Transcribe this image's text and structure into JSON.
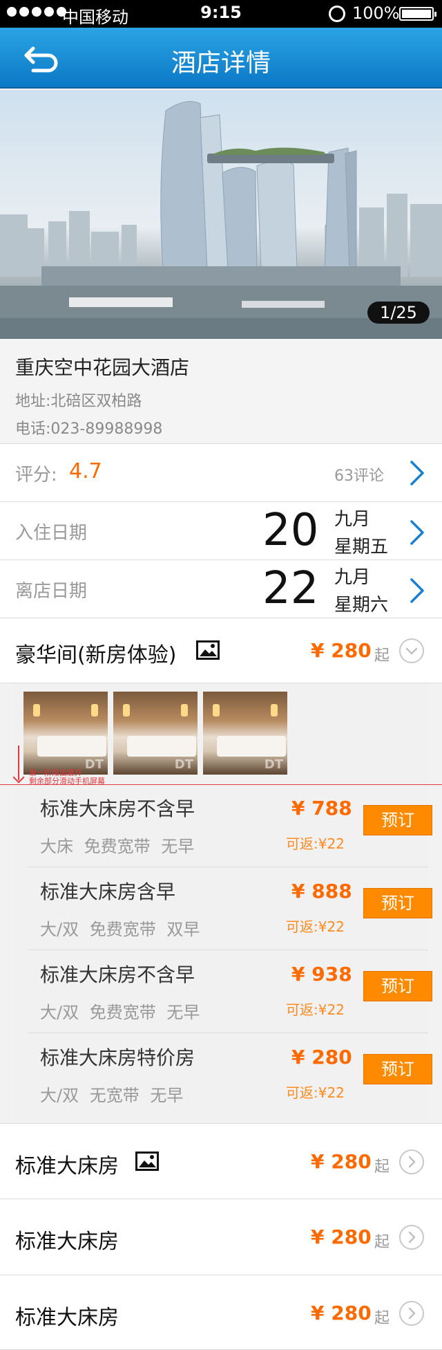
{
  "status_bar": {
    "carrier": "中国移动",
    "time": "9:15",
    "battery": "100%"
  },
  "nav": {
    "title": "酒店详情",
    "back_icon": "back-arrow-icon"
  },
  "hero": {
    "counter": "1/25"
  },
  "hotel": {
    "name": "重庆空中花园大酒店",
    "address": "地址:北碚区双柏路",
    "phone": "电话:023-89988998"
  },
  "rating": {
    "label": "评分:",
    "score": "4.7",
    "reviews": "63评论"
  },
  "checkin": {
    "label": "入住日期",
    "day": "20",
    "month": "九月",
    "weekday": "星期五"
  },
  "checkout": {
    "label": "离店日期",
    "day": "22",
    "month": "九月",
    "weekday": "星期六"
  },
  "featured_room": {
    "name": "豪华间(新房体验)",
    "price": "¥ 280",
    "suffix": "起",
    "thumb_watermark": "DT",
    "annotation": [
      "第一阶段由展开",
      "剩余部分滑动手机屏幕"
    ],
    "offers": [
      {
        "name": "标准大床房不含早",
        "desc": "大床 免费宽带 无早",
        "price": "¥ 788",
        "refund": "可返:¥22",
        "button": "预订"
      },
      {
        "name": "标准大床房含早",
        "desc": "大/双 免费宽带 双早",
        "price": "¥ 888",
        "refund": "可返:¥22",
        "button": "预订"
      },
      {
        "name": "标准大床房不含早",
        "desc": "大/双 免费宽带 无早",
        "price": "¥ 938",
        "refund": "可返:¥22",
        "button": "预订"
      },
      {
        "name": "标准大床房特价房",
        "desc": "大/双 无宽带 无早",
        "price": "¥ 280",
        "refund": "可返:¥22",
        "button": "预订"
      }
    ]
  },
  "rooms": [
    {
      "name": "标准大床房",
      "price": "¥ 280",
      "suffix": "起",
      "has_image": true
    },
    {
      "name": "标准大床房",
      "price": "¥ 280",
      "suffix": "起",
      "has_image": false
    },
    {
      "name": "标准大床房",
      "price": "¥ 280",
      "suffix": "起",
      "has_image": false
    }
  ],
  "colors": {
    "accent": "#ff6a00",
    "nav_blue": "#0b78c6",
    "book_button": "#ff8a00",
    "link_blue": "#1a7fd1"
  }
}
